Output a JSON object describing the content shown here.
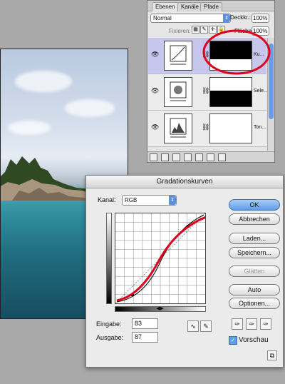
{
  "layers_panel": {
    "tabs": [
      "Ebenen",
      "Kanäle",
      "Pfade"
    ],
    "blend_mode": "Normal",
    "opacity_label": "Deckkr.:",
    "opacity_value": "100%",
    "lock_label": "Fixieren:",
    "fill_label": "Fläche:",
    "fill_value": "100%",
    "layers": [
      {
        "name": "Ku...",
        "selected": true
      },
      {
        "name": "Sele...",
        "selected": false
      },
      {
        "name": "Ton...",
        "selected": false
      }
    ]
  },
  "curves_dialog": {
    "title": "Gradationskurven",
    "channel_label": "Kanal:",
    "channel_value": "RGB",
    "input_label": "Eingabe:",
    "input_value": "83",
    "output_label": "Ausgabe:",
    "output_value": "87",
    "buttons": {
      "ok": "OK",
      "cancel": "Abbrechen",
      "load": "Laden...",
      "save": "Speichern...",
      "smooth": "Glätten",
      "auto": "Auto",
      "options": "Optionen..."
    },
    "preview_label": "Vorschau",
    "preview_checked": true
  },
  "colors": {
    "accent": "#5e9de8",
    "annotation": "#e0001b"
  }
}
